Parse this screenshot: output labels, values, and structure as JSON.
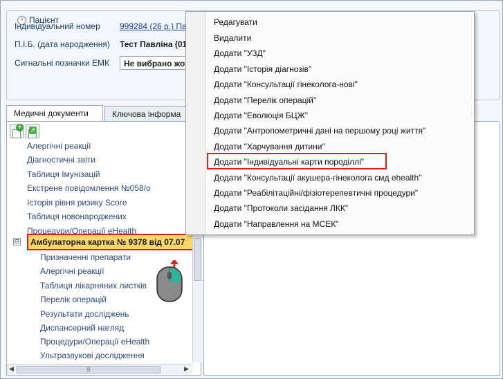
{
  "patient": {
    "legend": "Пацієнт",
    "fields": [
      {
        "label": "Індивідуальний номер",
        "value": "999284 (26 р.) Па"
      },
      {
        "label": "П.І.Б. (дата народження)",
        "value": "Тест Павліна (01"
      },
      {
        "label": "Сигнальні позначки ЕМК",
        "value": "Не вибрано жо"
      }
    ]
  },
  "tabs": [
    {
      "label": "Медичні документи",
      "active": true
    },
    {
      "label": "Ключова інформа",
      "active": false
    }
  ],
  "tree": {
    "items_above": [
      "Алергічні реакції",
      "Діагностичні звіти",
      "Таблиця Імунізацій",
      "Екстрене повідомлення №058/о",
      "Історія рівня ризику Score",
      "Таблиця новонароджених",
      "Процедури/Операції eHealth"
    ],
    "root": {
      "expander": "⊟",
      "label": "Амбулаторна картка № 9378 від 07.07"
    },
    "children": [
      "Призначенні препарати",
      "Алергічні реакції",
      "Таблиця лікарняних листків",
      "Перелік операцій",
      "Результати досліджень",
      "Диспансерний нагляд",
      "Процедури/Операції eHealth",
      "Ультразвукові дослідження"
    ]
  },
  "context_menu": {
    "items": [
      "Редагувати",
      "Видалити",
      "Додати \"УЗД\"",
      "Додати \"Історія діагнозів\"",
      "Додати \"Консультації гінеколога-нові\"",
      "Додати \"Перелік операцій\"",
      "Додати \"Еволюція БЦЖ\"",
      "Додати \"Антропометричні дані на першому році життя\"",
      "Додати \"Харчування дитини\"",
      "Додати \"Індивідуальні карти породіллі\"",
      "Додати \"Консультації акушера-гінеколога смд ehealth\"",
      "Додати \"Реабілітаційні/фізіотерепевтичні процедури\"",
      "Додати \"Протоколи засідання ЛКК\"",
      "Додати \"Направлення на МСЕК\""
    ],
    "highlighted_index": 9
  },
  "colors": {
    "highlight_border": "#e51b1b",
    "selected_row": "#fbd76a",
    "tree_text": "#2a4a80",
    "mouse_button": "#2bb59a"
  },
  "icons": {
    "collapse": "collapse-circle-icon",
    "add_doc": "add-document-icon",
    "export_doc": "export-document-icon",
    "mouse": "mouse-right-click-icon"
  }
}
